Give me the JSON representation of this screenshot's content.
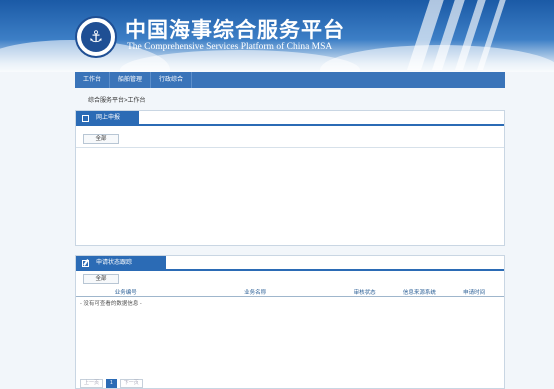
{
  "header": {
    "logo_text": "⚓",
    "title_cn": "中国海事综合服务平台",
    "title_en": "The Comprehensive Services Platform of China MSA"
  },
  "nav": {
    "items": [
      "工作台",
      "船舶管理",
      "行政综合"
    ]
  },
  "breadcrumb": "综合服务平台>工作台",
  "online_panel": {
    "title": "网上申报",
    "filter_all": "全部"
  },
  "status_panel": {
    "title": "申请状态跟踪",
    "filter_all": "全部",
    "columns": [
      "业务编号",
      "业务名称",
      "审核状态",
      "信息来源系统",
      "申请时间"
    ],
    "empty_text": "- 没有可查看的数据信息 -"
  },
  "pager": {
    "prev": "上一页",
    "current": "1",
    "next": "下一页"
  }
}
